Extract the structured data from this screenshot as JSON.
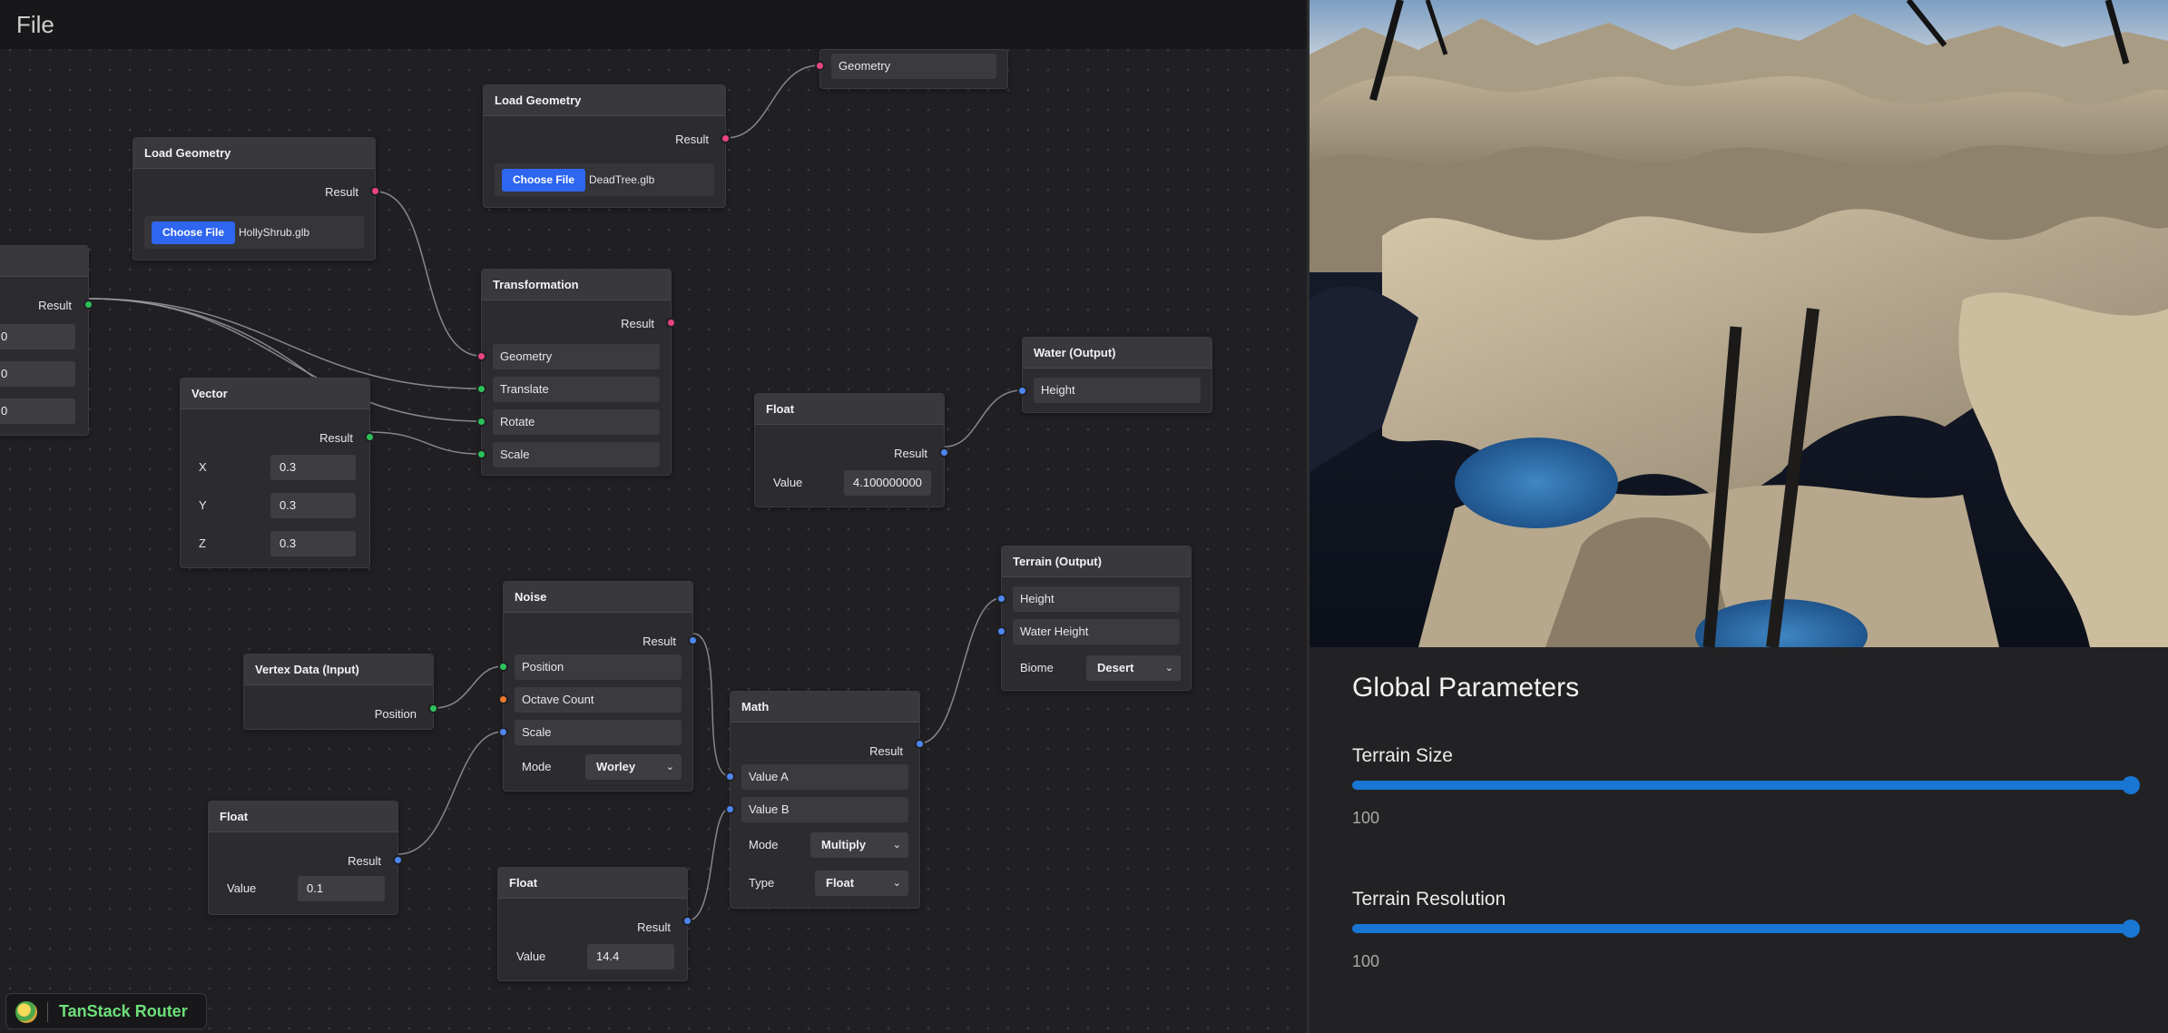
{
  "menu": {
    "file": "File"
  },
  "nodes": {
    "partial_geometry": {
      "input": "Geometry"
    },
    "load_geometry_1": {
      "title": "Load Geometry",
      "output": "Result",
      "button": "Choose File",
      "file": "DeadTree.glb"
    },
    "load_geometry_2": {
      "title": "Load Geometry",
      "output": "Result",
      "button": "Choose File",
      "file": "HollyShrub.glb"
    },
    "partial_left": {
      "output": "Result",
      "values": [
        "0",
        "0",
        "0"
      ]
    },
    "transformation": {
      "title": "Transformation",
      "output": "Result",
      "inputs": [
        "Geometry",
        "Translate",
        "Rotate",
        "Scale"
      ]
    },
    "vector": {
      "title": "Vector",
      "output": "Result",
      "x_label": "X",
      "x": "0.3",
      "y_label": "Y",
      "y": "0.3",
      "z_label": "Z",
      "z": "0.3"
    },
    "float_water": {
      "title": "Float",
      "output": "Result",
      "value_label": "Value",
      "value": "4.100000000"
    },
    "water_output": {
      "title": "Water (Output)",
      "input": "Height"
    },
    "terrain_output": {
      "title": "Terrain (Output)",
      "inputs": [
        "Height",
        "Water Height"
      ],
      "biome_label": "Biome",
      "biome": "Desert"
    },
    "noise": {
      "title": "Noise",
      "output": "Result",
      "inputs": [
        "Position",
        "Octave Count",
        "Scale"
      ],
      "mode_label": "Mode",
      "mode": "Worley"
    },
    "vertex_data": {
      "title": "Vertex Data (Input)",
      "output": "Position"
    },
    "math": {
      "title": "Math",
      "output": "Result",
      "inputs": [
        "Value A",
        "Value B"
      ],
      "mode_label": "Mode",
      "mode": "Multiply",
      "type_label": "Type",
      "type": "Float"
    },
    "float_scale": {
      "title": "Float",
      "output": "Result",
      "value_label": "Value",
      "value": "0.1"
    },
    "float_mult": {
      "title": "Float",
      "output": "Result",
      "value_label": "Value",
      "value": "14.4"
    }
  },
  "router_badge": {
    "label": "TanStack Router"
  },
  "params": {
    "title": "Global Parameters",
    "terrain_size": {
      "label": "Terrain Size",
      "value": "100",
      "fraction": 1.0
    },
    "terrain_resolution": {
      "label": "Terrain Resolution",
      "value": "100",
      "fraction": 1.0
    }
  },
  "colors": {
    "geometry_socket": "#e8447f",
    "vector_socket": "#2bc25a",
    "float_socket": "#4d86f0",
    "int_socket": "#f07a2e",
    "accent": "#1976d2",
    "file_button": "#2f66f0"
  }
}
